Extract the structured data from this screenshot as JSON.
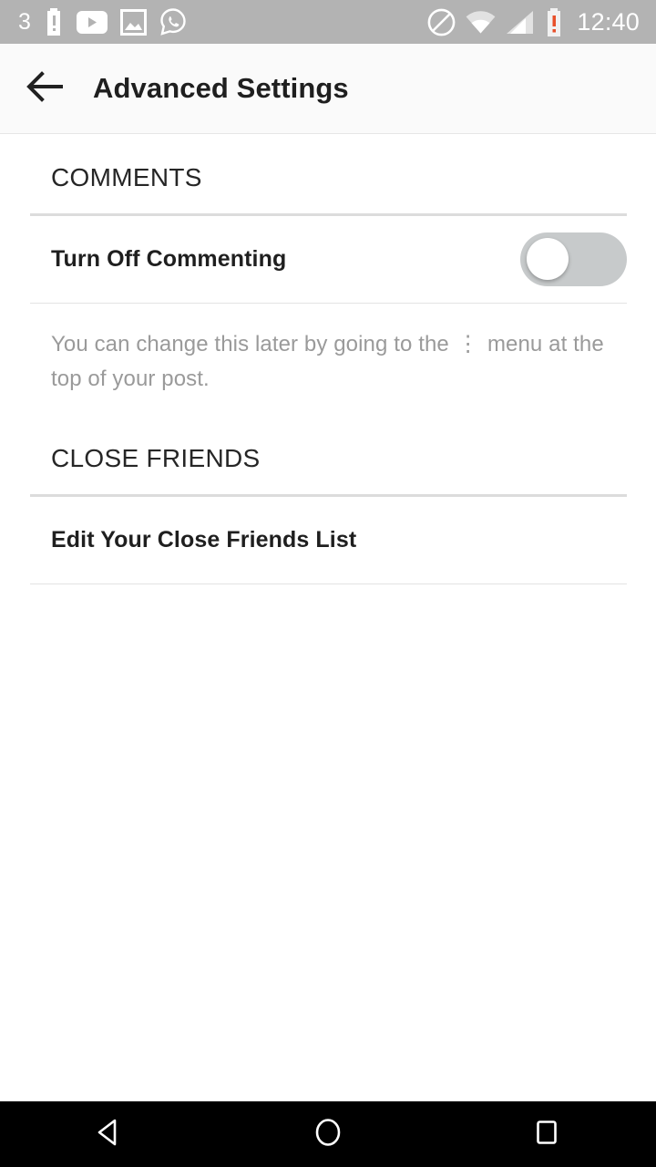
{
  "status_bar": {
    "notification_count": "3",
    "clock": "12:40",
    "background_color": "#b3b3b3",
    "left_icons": [
      {
        "name": "notification-count",
        "label": "3"
      },
      {
        "name": "battery-alert-icon",
        "label": "battery-alert"
      },
      {
        "name": "youtube-icon",
        "label": "youtube"
      },
      {
        "name": "photo-icon",
        "label": "photo"
      },
      {
        "name": "whatsapp-icon",
        "label": "whatsapp"
      }
    ],
    "right_icons": [
      {
        "name": "do-not-disturb-icon",
        "label": "do-not-disturb"
      },
      {
        "name": "wifi-icon",
        "label": "wifi"
      },
      {
        "name": "cell-signal-icon",
        "label": "cell-signal"
      },
      {
        "name": "battery-alert-icon",
        "label": "battery-alert"
      }
    ],
    "battery_alert_color": "#e8502a"
  },
  "app_bar": {
    "title": "Advanced Settings",
    "back_icon": "arrow-left-icon",
    "background_color": "#fafafa"
  },
  "sections": [
    {
      "header": "COMMENTS",
      "rows": [
        {
          "label": "Turn Off Commenting",
          "control": "toggle",
          "toggle_state": "off"
        }
      ],
      "helper_text_before_dots": "You can change this later by going to the",
      "helper_dots": "⋮",
      "helper_text_after_dots": "menu at the top of your post."
    },
    {
      "header": "CLOSE FRIENDS",
      "rows": [
        {
          "label": "Edit Your Close Friends List",
          "control": "none"
        }
      ]
    }
  ],
  "nav_bar": {
    "background_color": "#000000",
    "buttons": [
      {
        "name": "nav-back-button",
        "icon": "triangle-left-icon"
      },
      {
        "name": "nav-home-button",
        "icon": "circle-icon"
      },
      {
        "name": "nav-recents-button",
        "icon": "square-icon"
      }
    ]
  }
}
